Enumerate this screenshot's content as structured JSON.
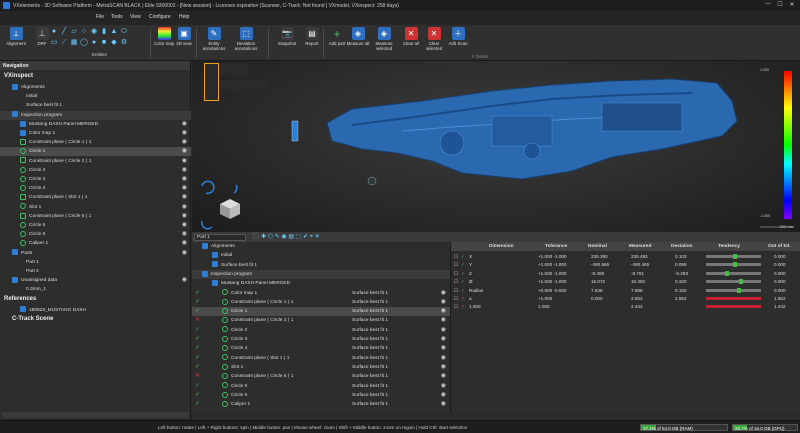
{
  "window": {
    "title": "VXelements - 3D Software Platform - MetraSCAN BLACK | Elite 9300002 - [New session] - Licenses expiration (Scanner, C-Track: Not found | VXmodel, VXinspect: 258 days)",
    "min": "—",
    "max": "☐",
    "close": "✕"
  },
  "menu": [
    "File",
    "Tools",
    "View",
    "Configure",
    "Help"
  ],
  "ribbon": {
    "alignment": "Alignment",
    "drf": "DRF",
    "entities": "Entities",
    "color_map": "Color map",
    "view_3d": "2D view",
    "entity_annotations": "Entity annotations",
    "deviation_annotations": "Deviation annotations",
    "snapshot": "Snapshot",
    "report": "Report",
    "add_part": "Add part",
    "measure_all": "Measure all",
    "measure_selected": "Measure selected",
    "clear_all": "Clear all",
    "clear_selected": "Clear selected",
    "add_scan": "Add Scan",
    "delete": "Delete",
    "copy": "Copy",
    "cut": "Cut"
  },
  "navigation": {
    "header": "Navigation",
    "vxinspect": "VXinspect",
    "alignments": "Alignments",
    "initial": "Initial",
    "surface_best_fit": "Surface best fit 1",
    "inspection_program": "Inspection program",
    "items": [
      {
        "label": "Mustang DASH Panel MERGED",
        "type": "mesh"
      },
      {
        "label": "Color map 1",
        "type": "map"
      },
      {
        "label": "Constraint plane ( Circle 1 ) 1",
        "type": "plane"
      },
      {
        "label": "Circle 1",
        "type": "circle"
      },
      {
        "label": "Constraint plane ( Circle 2 ) 1",
        "type": "plane"
      },
      {
        "label": "Circle 2",
        "type": "circle"
      },
      {
        "label": "Circle 3",
        "type": "circle"
      },
      {
        "label": "Circle 4",
        "type": "circle"
      },
      {
        "label": "Constraint plane ( Slot 1 ) 1",
        "type": "plane"
      },
      {
        "label": "Slot 1",
        "type": "slot"
      },
      {
        "label": "Constraint plane ( Circle 5 ) 1",
        "type": "plane"
      },
      {
        "label": "Circle 5",
        "type": "circle"
      },
      {
        "label": "Circle 6",
        "type": "circle"
      },
      {
        "label": "Caliper 1",
        "type": "caliper"
      }
    ],
    "parts": "Parts",
    "part1": "Part 1",
    "part2": "Part 2",
    "unassigned": "Unassigned data",
    "mm": "0.3mm_1",
    "references": "References",
    "ref_item": "180928_MUSTANG DASH",
    "ctrack": "C-Track Scene"
  },
  "viewport": {
    "scale": "200 mm",
    "cb_top": "1.000",
    "cb_bottom": "-1.000"
  },
  "lower": {
    "part_selector": "Part 1",
    "tree_items": [
      {
        "label": "Alignments",
        "align": "",
        "status": ""
      },
      {
        "label": "Initial",
        "align": "",
        "status": ""
      },
      {
        "label": "Surface best fit 1",
        "align": "",
        "status": ""
      },
      {
        "label": "Inspection program",
        "align": "",
        "status": ""
      },
      {
        "label": "Mustang DASH Panel MERGED",
        "align": "",
        "status": ""
      },
      {
        "label": "Color map 1",
        "align": "Surface best fit 1",
        "status": "ok"
      },
      {
        "label": "Constraint plane ( Circle 1 ) 1",
        "align": "Surface best fit 1",
        "status": "ok"
      },
      {
        "label": "Circle 1",
        "align": "Surface best fit 1",
        "status": "ok"
      },
      {
        "label": "Constraint plane ( Circle 2 ) 1",
        "align": "Surface best fit 1",
        "status": "bad"
      },
      {
        "label": "Circle 2",
        "align": "Surface best fit 1",
        "status": "ok"
      },
      {
        "label": "Circle 3",
        "align": "Surface best fit 1",
        "status": "ok"
      },
      {
        "label": "Circle 4",
        "align": "Surface best fit 1",
        "status": "ok"
      },
      {
        "label": "Constraint plane ( Slot 1 ) 1",
        "align": "Surface best fit 1",
        "status": "ok"
      },
      {
        "label": "Slot 1",
        "align": "Surface best fit 1",
        "status": "ok"
      },
      {
        "label": "Constraint plane ( Circle 5 ) 1",
        "align": "Surface best fit 1",
        "status": "bad"
      },
      {
        "label": "Circle 5",
        "align": "Surface best fit 1",
        "status": "ok"
      },
      {
        "label": "Circle 6",
        "align": "Surface best fit 1",
        "status": "ok"
      },
      {
        "label": "Caliper 1",
        "align": "Surface best fit 1",
        "status": "ok"
      }
    ],
    "table_headers": [
      "Dimension",
      "Tolerance",
      "Nominal",
      "Measured",
      "Deviation",
      "Tendency",
      "Out of tol."
    ],
    "table_rows": [
      {
        "dim": "X",
        "tol": "+1.000 -1.000",
        "nom": "239.390",
        "meas": "239.493",
        "dev": "0.103",
        "out": "0.000",
        "trend": 0.52,
        "bad": false
      },
      {
        "dim": "Y",
        "tol": "+1.000 -1.000",
        "nom": "-490.565",
        "meas": "-490.465",
        "dev": "0.099",
        "out": "0.000",
        "trend": 0.52,
        "bad": false
      },
      {
        "dim": "Z",
        "tol": "+1.000 -1.000",
        "nom": "-8.408",
        "meas": "-8.701",
        "dev": "-0.293",
        "out": "0.000",
        "trend": 0.38,
        "bad": false
      },
      {
        "dim": "Ø",
        "tol": "+1.000 -1.000",
        "nom": "15.072",
        "meas": "15.392",
        "dev": "0.320",
        "out": "0.000",
        "trend": 0.65,
        "bad": false
      },
      {
        "dim": "Radius",
        "tol": "+0.500 -0.500",
        "nom": "7.536",
        "meas": "7.696",
        "dev": "0.160",
        "out": "0.000",
        "trend": 0.6,
        "bad": false
      },
      {
        "dim": "a",
        "tol": "+1.000",
        "nom": "0.000",
        "meas": "2.552",
        "dev": "2.552",
        "out": "1.552",
        "trend": 1,
        "bad": true
      },
      {
        "dim": "1.000",
        "tol": "1.000",
        "nom": "",
        "meas": "2.442",
        "dev": "",
        "out": "1.442",
        "trend": 1,
        "bad": true
      }
    ]
  },
  "status": {
    "msg": "Left button: rotate  |  Left + Right buttons: spin  |  Middle button: pan  |  Mouse wheel: zoom  |  Shift + Middle button: zoom on region  |  Hold Ctrl: start selection",
    "mem1": "17.1% of 64.0 GB (RAM)",
    "mem1_pct": 0.171,
    "mem2": "20.7% of 16.0 GB (GPU)",
    "mem2_pct": 0.207
  }
}
